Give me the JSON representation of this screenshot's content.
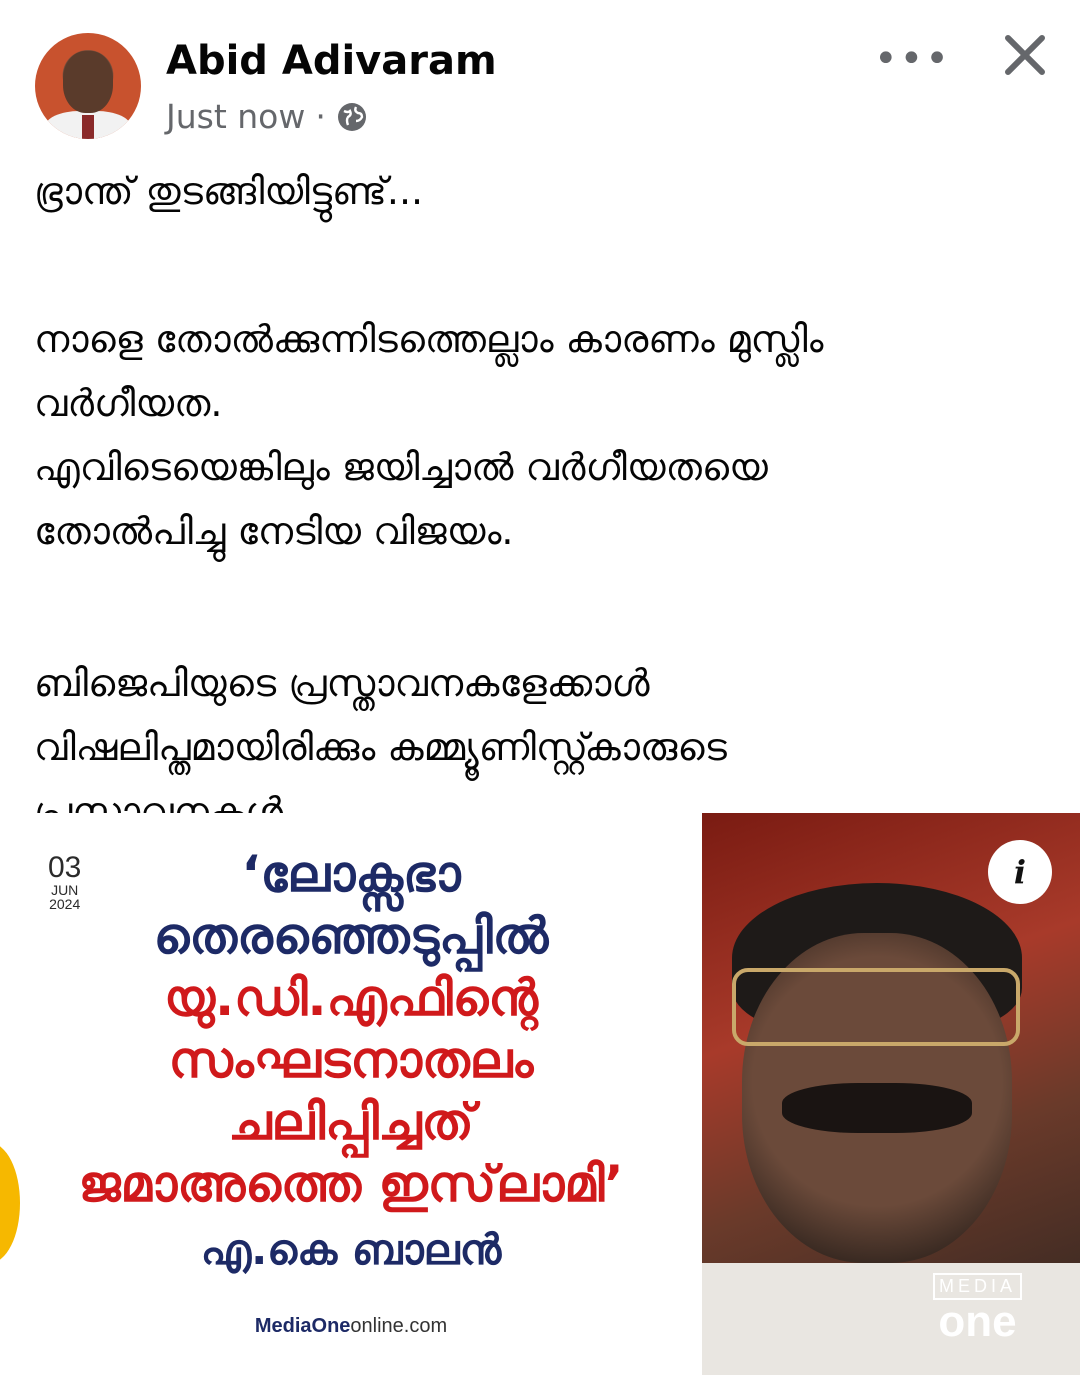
{
  "post": {
    "author": "Abid Adivaram",
    "time": "Just now",
    "separator": "·",
    "more_label": "•••",
    "text": {
      "l1": "ഭ്രാന്ത് തുടങ്ങിയിട്ടുണ്ട്...",
      "l2": "നാളെ തോൽക്കുന്നിടത്തെല്ലാം കാരണം മുസ്ലിം",
      "l3": "വർഗീയത.",
      "l4": "എവിടെയെങ്കിലും ജയിച്ചാൽ വർഗീയതയെ",
      "l5": "തോൽപിച്ചു നേടിയ വിജയം.",
      "l6": "ബിജെപിയുടെ പ്രസ്താവനകളേക്കാൾ",
      "l7": "വിഷലിപ്തമായിരിക്കും കമ്മ്യൂണിസ്റ്റ്കാരുടെ",
      "l8": "പ്രസ്താവനകൾ."
    }
  },
  "image_card": {
    "date_day": "03",
    "date_month": "JUN",
    "date_year": "2024",
    "headline": {
      "h1": "‘ലോക്സഭാ",
      "h2": "തെരഞ്ഞെടുപ്പിൽ",
      "h3": "യു.ഡി.എഫിന്റെ",
      "h4": "സംഘടനാതലം",
      "h5": "ചലിപ്പിച്ചത്",
      "h6": "ജമാഅത്തെ ഇസ്‌ലാമി’"
    },
    "attribution": "എ.കെ ബാലൻ",
    "site_bold": "MediaOne",
    "site_rest": "online.com",
    "info_label": "i",
    "logo_top": "MEDIA",
    "logo_bottom": "one"
  },
  "colors": {
    "headline_blue": "#1d2a66",
    "headline_red": "#d0191b",
    "meta_gray": "#65676b"
  }
}
